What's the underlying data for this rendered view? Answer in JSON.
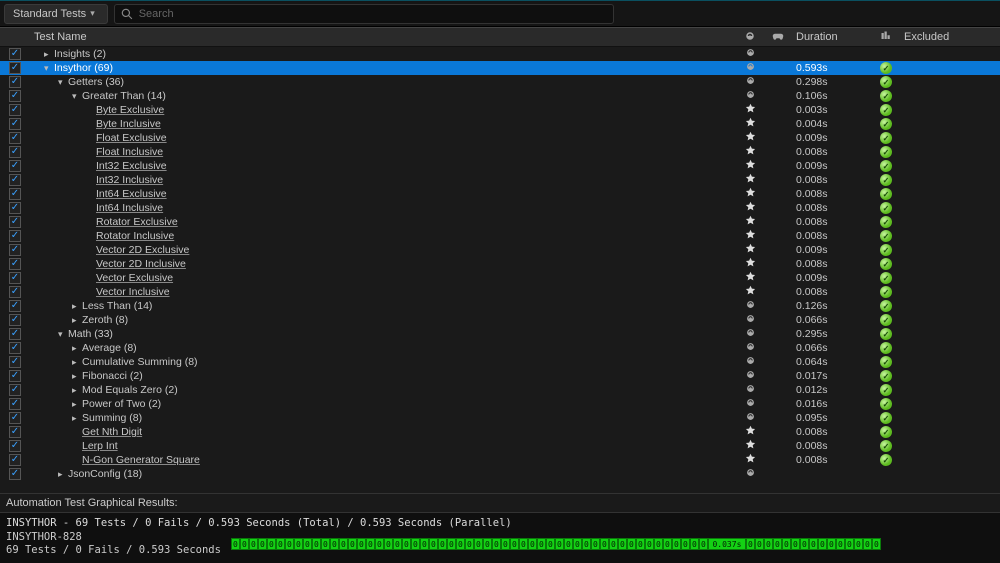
{
  "toolbar": {
    "dropdown_label": "Standard Tests",
    "search_placeholder": "Search"
  },
  "columns": {
    "name": "Test Name",
    "duration": "Duration",
    "excluded": "Excluded"
  },
  "rows": [
    {
      "indent": 1,
      "exp": "r",
      "label": "Insights (2)",
      "kind": "group",
      "selected": false,
      "duration": "",
      "status": false,
      "checked": true
    },
    {
      "indent": 1,
      "exp": "d",
      "label": "Insythor (69)",
      "kind": "group",
      "selected": true,
      "duration": "0.593s",
      "status": true,
      "checked": true
    },
    {
      "indent": 2,
      "exp": "d",
      "label": "Getters (36)",
      "kind": "group",
      "selected": false,
      "duration": "0.298s",
      "status": true,
      "checked": true
    },
    {
      "indent": 3,
      "exp": "d",
      "label": "Greater Than (14)",
      "kind": "group",
      "selected": false,
      "duration": "0.106s",
      "status": true,
      "checked": true
    },
    {
      "indent": 4,
      "exp": "",
      "label": "Byte Exclusive",
      "kind": "leaf",
      "selected": false,
      "duration": "0.003s",
      "status": true,
      "checked": true
    },
    {
      "indent": 4,
      "exp": "",
      "label": "Byte Inclusive",
      "kind": "leaf",
      "selected": false,
      "duration": "0.004s",
      "status": true,
      "checked": true
    },
    {
      "indent": 4,
      "exp": "",
      "label": "Float Exclusive",
      "kind": "leaf",
      "selected": false,
      "duration": "0.009s",
      "status": true,
      "checked": true
    },
    {
      "indent": 4,
      "exp": "",
      "label": "Float Inclusive",
      "kind": "leaf",
      "selected": false,
      "duration": "0.008s",
      "status": true,
      "checked": true
    },
    {
      "indent": 4,
      "exp": "",
      "label": "Int32 Exclusive",
      "kind": "leaf",
      "selected": false,
      "duration": "0.009s",
      "status": true,
      "checked": true
    },
    {
      "indent": 4,
      "exp": "",
      "label": "Int32 Inclusive",
      "kind": "leaf",
      "selected": false,
      "duration": "0.008s",
      "status": true,
      "checked": true
    },
    {
      "indent": 4,
      "exp": "",
      "label": "Int64 Exclusive",
      "kind": "leaf",
      "selected": false,
      "duration": "0.008s",
      "status": true,
      "checked": true
    },
    {
      "indent": 4,
      "exp": "",
      "label": "Int64 Inclusive",
      "kind": "leaf",
      "selected": false,
      "duration": "0.008s",
      "status": true,
      "checked": true
    },
    {
      "indent": 4,
      "exp": "",
      "label": "Rotator Exclusive",
      "kind": "leaf",
      "selected": false,
      "duration": "0.008s",
      "status": true,
      "checked": true
    },
    {
      "indent": 4,
      "exp": "",
      "label": "Rotator Inclusive",
      "kind": "leaf",
      "selected": false,
      "duration": "0.008s",
      "status": true,
      "checked": true
    },
    {
      "indent": 4,
      "exp": "",
      "label": "Vector 2D Exclusive",
      "kind": "leaf",
      "selected": false,
      "duration": "0.009s",
      "status": true,
      "checked": true
    },
    {
      "indent": 4,
      "exp": "",
      "label": "Vector 2D Inclusive",
      "kind": "leaf",
      "selected": false,
      "duration": "0.008s",
      "status": true,
      "checked": true
    },
    {
      "indent": 4,
      "exp": "",
      "label": "Vector Exclusive",
      "kind": "leaf",
      "selected": false,
      "duration": "0.009s",
      "status": true,
      "checked": true
    },
    {
      "indent": 4,
      "exp": "",
      "label": "Vector Inclusive",
      "kind": "leaf",
      "selected": false,
      "duration": "0.008s",
      "status": true,
      "checked": true
    },
    {
      "indent": 3,
      "exp": "r",
      "label": "Less Than (14)",
      "kind": "group",
      "selected": false,
      "duration": "0.126s",
      "status": true,
      "checked": true
    },
    {
      "indent": 3,
      "exp": "r",
      "label": "Zeroth (8)",
      "kind": "group",
      "selected": false,
      "duration": "0.066s",
      "status": true,
      "checked": true
    },
    {
      "indent": 2,
      "exp": "d",
      "label": "Math (33)",
      "kind": "group",
      "selected": false,
      "duration": "0.295s",
      "status": true,
      "checked": true
    },
    {
      "indent": 3,
      "exp": "r",
      "label": "Average (8)",
      "kind": "group",
      "selected": false,
      "duration": "0.066s",
      "status": true,
      "checked": true
    },
    {
      "indent": 3,
      "exp": "r",
      "label": "Cumulative Summing (8)",
      "kind": "group",
      "selected": false,
      "duration": "0.064s",
      "status": true,
      "checked": true
    },
    {
      "indent": 3,
      "exp": "r",
      "label": "Fibonacci (2)",
      "kind": "group",
      "selected": false,
      "duration": "0.017s",
      "status": true,
      "checked": true
    },
    {
      "indent": 3,
      "exp": "r",
      "label": "Mod Equals Zero (2)",
      "kind": "group",
      "selected": false,
      "duration": "0.012s",
      "status": true,
      "checked": true
    },
    {
      "indent": 3,
      "exp": "r",
      "label": "Power of Two (2)",
      "kind": "group",
      "selected": false,
      "duration": "0.016s",
      "status": true,
      "checked": true
    },
    {
      "indent": 3,
      "exp": "r",
      "label": "Summing (8)",
      "kind": "group",
      "selected": false,
      "duration": "0.095s",
      "status": true,
      "checked": true
    },
    {
      "indent": 3,
      "exp": "",
      "label": "Get Nth Digit",
      "kind": "leaf",
      "selected": false,
      "duration": "0.008s",
      "status": true,
      "checked": true
    },
    {
      "indent": 3,
      "exp": "",
      "label": "Lerp Int",
      "kind": "leaf",
      "selected": false,
      "duration": "0.008s",
      "status": true,
      "checked": true
    },
    {
      "indent": 3,
      "exp": "",
      "label": "N-Gon Generator Square",
      "kind": "leaf",
      "selected": false,
      "duration": "0.008s",
      "status": true,
      "checked": true
    },
    {
      "indent": 2,
      "exp": "r",
      "label": "JsonConfig (18)",
      "kind": "group",
      "selected": false,
      "duration": "",
      "status": false,
      "checked": true
    }
  ],
  "results_label": "Automation Test Graphical Results:",
  "console": {
    "summary": "INSYTHOR  -  69 Tests / 0 Fails / 0.593 Seconds (Total) / 0.593 Seconds (Parallel)",
    "machine": "INSYTHOR-828",
    "footer": "69 Tests / 0 Fails / 0.593 Seconds",
    "block_label": "0.037s",
    "block_count": 69
  }
}
